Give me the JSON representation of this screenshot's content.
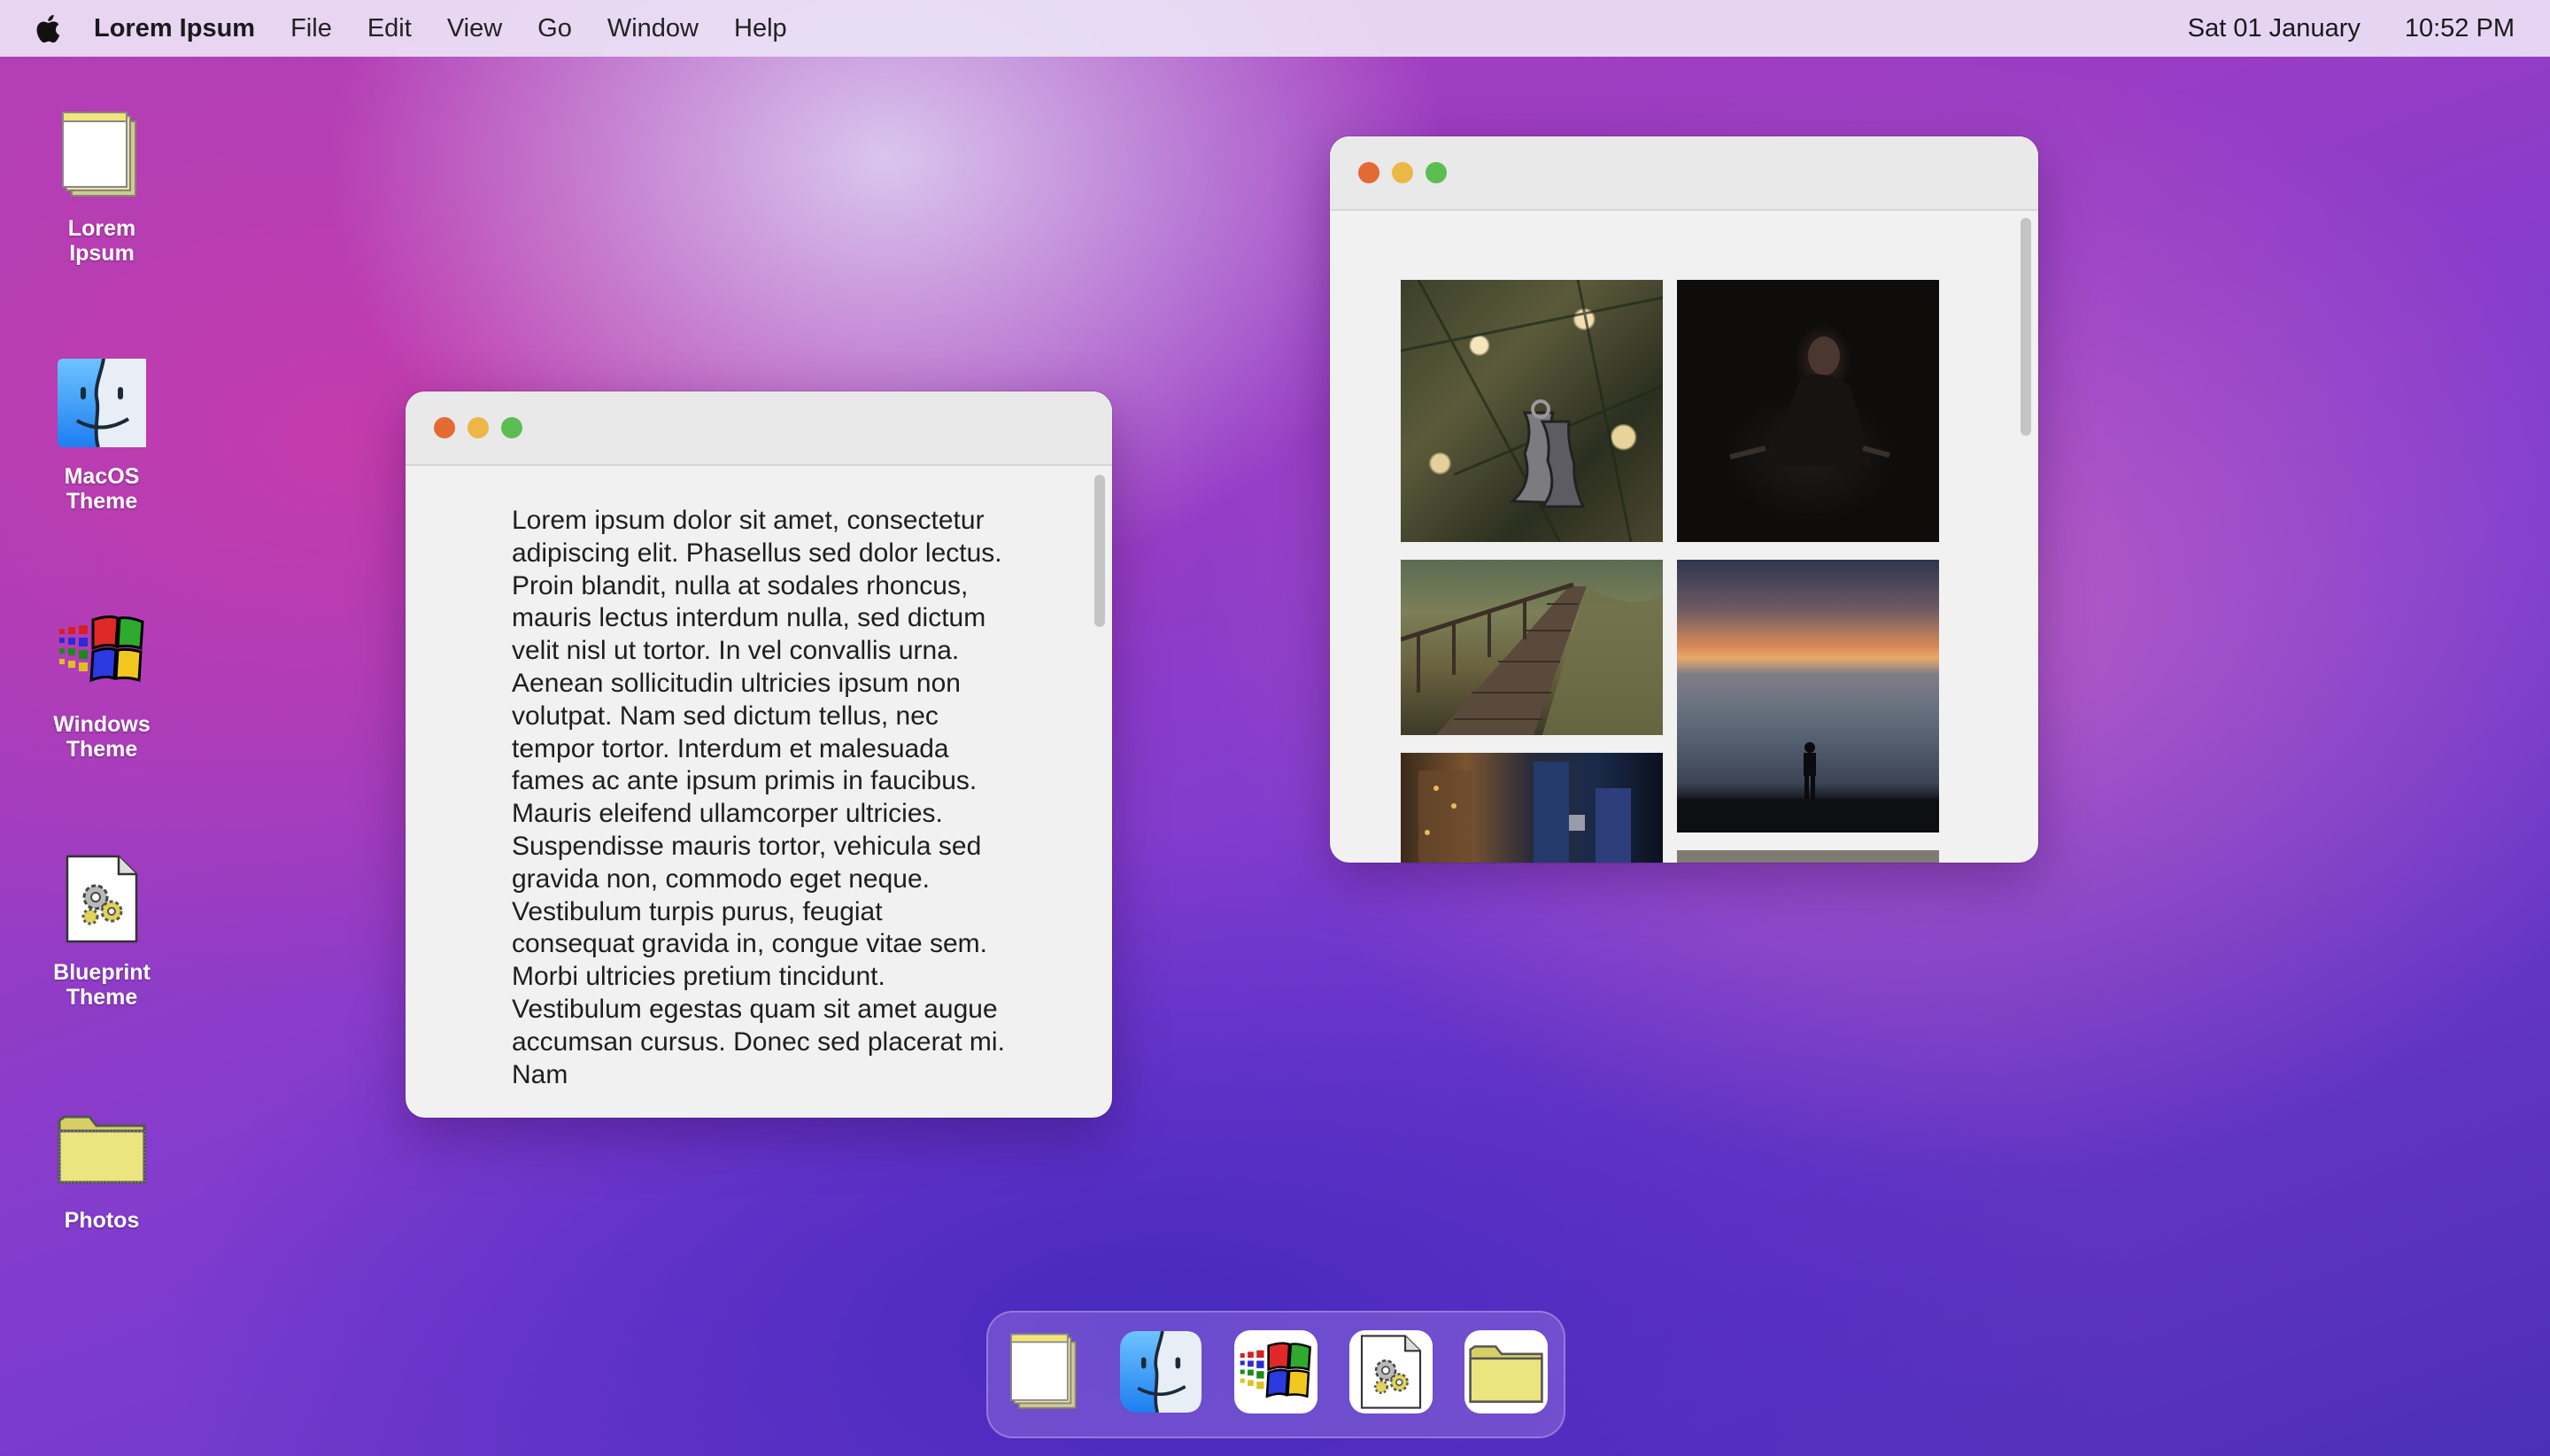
{
  "menubar": {
    "apple_icon": "apple-icon",
    "app_name": "Lorem Ipsum",
    "menus": [
      "File",
      "Edit",
      "View",
      "Go",
      "Window",
      "Help"
    ],
    "date": "Sat 01 January",
    "time": "10:52 PM"
  },
  "desktop_icons": [
    {
      "label": "Lorem Ipsum",
      "icon": "notepad-icon"
    },
    {
      "label": "MacOS Theme",
      "icon": "finder-icon"
    },
    {
      "label": "Windows Theme",
      "icon": "windows-logo-icon"
    },
    {
      "label": "Blueprint Theme",
      "icon": "blueprint-gear-document-icon"
    },
    {
      "label": "Photos",
      "icon": "folder-icon"
    }
  ],
  "text_window": {
    "body": "Lorem ipsum dolor sit amet, consectetur adipiscing elit. Phasellus sed dolor lectus. Proin blandit, nulla at sodales rhoncus, mauris lectus interdum nulla, sed dictum velit nisl ut tortor. In vel convallis urna. Aenean sollicitudin ultricies ipsum non volutpat. Nam sed dictum tellus, nec tempor tortor. Interdum et malesuada fames ac ante ipsum primis in faucibus. Mauris eleifend ullamcorper ultricies. Suspendisse mauris tortor, vehicula sed gravida non, commodo eget neque. Vestibulum turpis purus, feugiat consequat gravida in, congue vitae sem. Morbi ultricies pretium tincidunt. Vestibulum egestas quam sit amet augue accumsan cursus. Donec sed placerat mi. Nam"
  },
  "photos_window": {
    "photos": [
      {
        "subject": "christmas-bells-photo"
      },
      {
        "subject": "dark-portrait-photo"
      },
      {
        "subject": "wooden-boardwalk-photo"
      },
      {
        "subject": "sunset-beach-silhouette-photo"
      },
      {
        "subject": "city-night-street-photo"
      },
      {
        "subject": "partial-photo"
      }
    ]
  },
  "dock": {
    "items": [
      "notepad-icon",
      "finder-icon",
      "windows-logo-icon",
      "blueprint-gear-document-icon",
      "folder-icon"
    ]
  },
  "colors": {
    "close": "#e36a32",
    "minimize": "#ebb845",
    "maximize": "#5cbd52"
  }
}
